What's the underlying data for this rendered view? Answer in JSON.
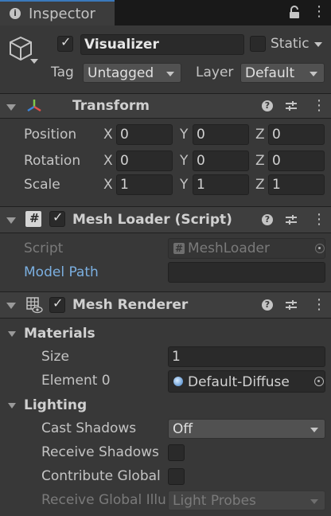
{
  "tab": {
    "title": "Inspector"
  },
  "gameobject": {
    "name": "Visualizer",
    "static_label": "Static",
    "tag_label": "Tag",
    "tag_value": "Untagged",
    "layer_label": "Layer",
    "layer_value": "Default"
  },
  "transform": {
    "title": "Transform",
    "rows": [
      {
        "label": "Position",
        "x": "0",
        "y": "0",
        "z": "0"
      },
      {
        "label": "Rotation",
        "x": "0",
        "y": "0",
        "z": "0"
      },
      {
        "label": "Scale",
        "x": "1",
        "y": "1",
        "z": "1"
      }
    ],
    "axis_x": "X",
    "axis_y": "Y",
    "axis_z": "Z"
  },
  "mesh_loader": {
    "title": "Mesh Loader (Script)",
    "script_label": "Script",
    "script_value": "MeshLoader",
    "model_path_label": "Model Path",
    "model_path_value": ""
  },
  "mesh_renderer": {
    "title": "Mesh Renderer",
    "materials_label": "Materials",
    "size_label": "Size",
    "size_value": "1",
    "element0_label": "Element 0",
    "element0_value": "Default-Diffuse",
    "lighting_label": "Lighting",
    "cast_shadows_label": "Cast Shadows",
    "cast_shadows_value": "Off",
    "receive_shadows_label": "Receive Shadows",
    "contribute_gi_label": "Contribute Global",
    "receive_gi_label": "Receive Global Illu",
    "receive_gi_value": "Light Probes"
  },
  "icons": {
    "help": "?",
    "kebab": "⋮",
    "check": "✓",
    "script_glyph": "#"
  }
}
